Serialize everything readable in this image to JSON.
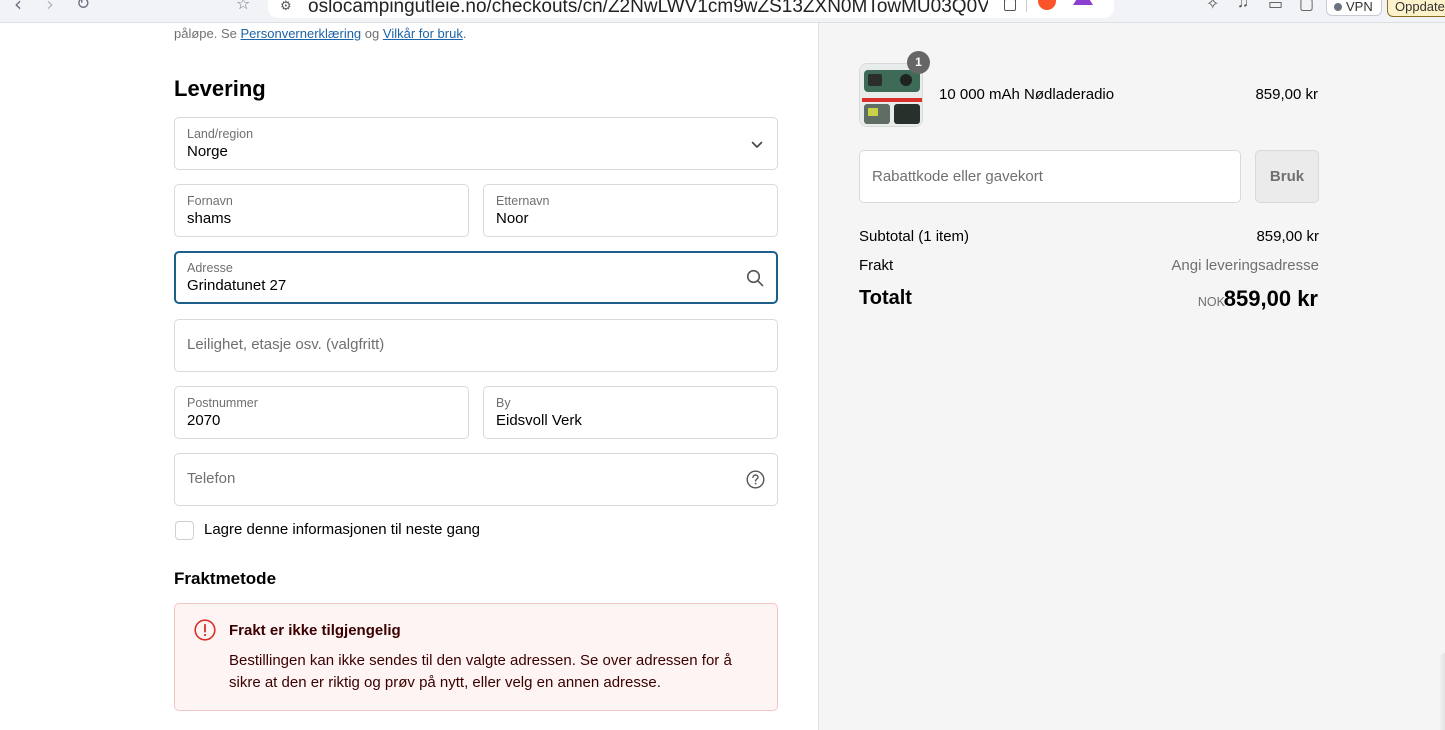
{
  "browser": {
    "url": "oslocampingutleie.no/checkouts/cn/Z2NwLWV1cm9wZS13ZXN0MTowMU03Q0VKRDRHOVhGSjZ...",
    "vpn_label": "VPN",
    "update_label": "Oppdate"
  },
  "legal": {
    "prefix": "påløpe. Se",
    "privacy_link": "Personvernerklæring",
    "conjunction": "og",
    "terms_link": "Vilkår for bruk",
    "suffix": "."
  },
  "delivery": {
    "title": "Levering",
    "country": {
      "label": "Land/region",
      "value": "Norge"
    },
    "first_name": {
      "label": "Fornavn",
      "value": "shams"
    },
    "last_name": {
      "label": "Etternavn",
      "value": "Noor"
    },
    "address": {
      "label": "Adresse",
      "value": "Grindatunet 27"
    },
    "apartment": {
      "placeholder": "Leilighet, etasje osv. (valgfritt)"
    },
    "postal_code": {
      "label": "Postnummer",
      "value": "2070"
    },
    "city": {
      "label": "By",
      "value": "Eidsvoll Verk"
    },
    "phone": {
      "placeholder": "Telefon"
    },
    "save_info_label": "Lagre denne informasjonen til neste gang",
    "save_info_checked": false
  },
  "shipping": {
    "title": "Fraktmetode",
    "alert_title": "Frakt er ikke tilgjengelig",
    "alert_body": "Bestillingen kan ikke sendes til den valgte adressen. Se over adressen for å sikre at den er riktig og prøv på nytt, eller velg en annen adresse."
  },
  "summary": {
    "item": {
      "quantity": "1",
      "name": "10 000 mAh Nødladeradio",
      "price": "859,00 kr"
    },
    "discount_placeholder": "Rabattkode eller gavekort",
    "apply_label": "Bruk",
    "subtotal_label": "Subtotal (1 item)",
    "subtotal_value": "859,00 kr",
    "shipping_label": "Frakt",
    "shipping_value": "Angi leveringsadresse",
    "total_label": "Totalt",
    "currency": "NOK",
    "total_value": "859,00 kr"
  },
  "colors": {
    "link": "#1c63a8",
    "focus_border": "#1c5f8a",
    "error_red": "#d9302c",
    "alert_bg": "#fff4f4",
    "summary_bg": "#f5f5f5"
  }
}
